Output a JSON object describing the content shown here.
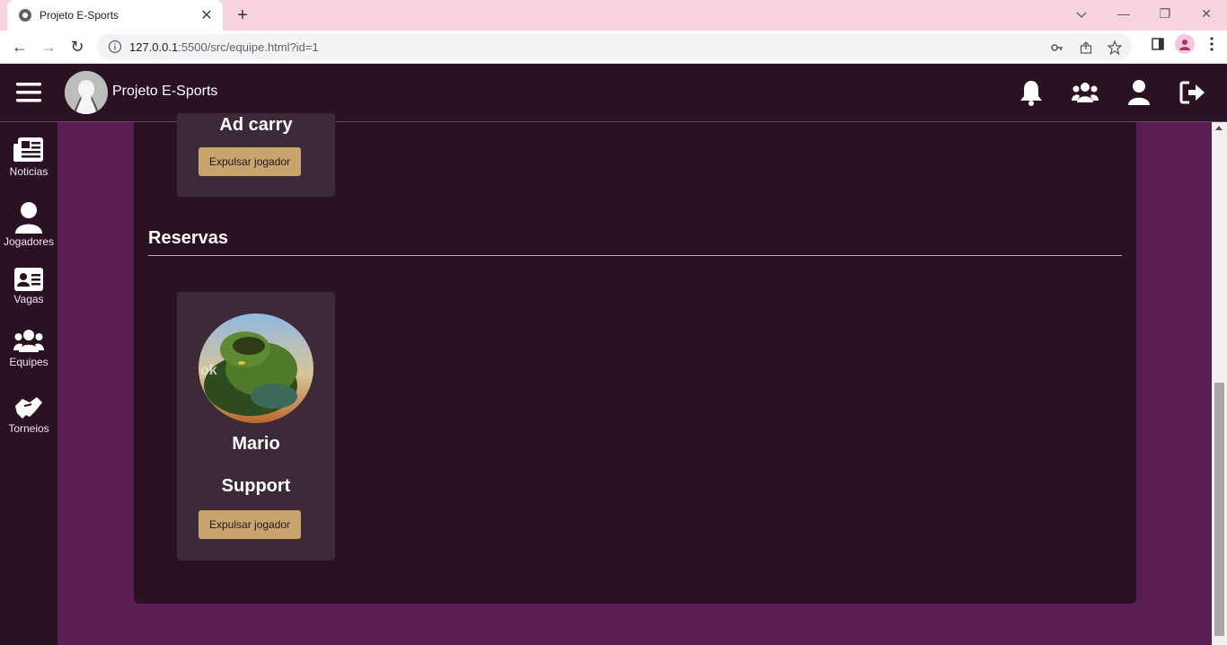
{
  "browser": {
    "tab_title": "Projeto E-Sports",
    "url_host": "127.0.0.1",
    "url_rest": ":5500/src/equipe.html?id=1"
  },
  "app": {
    "brand_name": "Projeto E-Sports",
    "sidebar": [
      {
        "label": "Noticias",
        "icon": "newspaper-icon"
      },
      {
        "label": "Jogadores",
        "icon": "user-icon"
      },
      {
        "label": "Vagas",
        "icon": "id-card-icon"
      },
      {
        "label": "Equipes",
        "icon": "users-icon"
      },
      {
        "label": "Torneios",
        "icon": "handshake-icon"
      }
    ],
    "top_icons": [
      "bell-icon",
      "users-icon",
      "user-icon",
      "logout-icon"
    ]
  },
  "team": {
    "top_card": {
      "role": "Ad carry",
      "button_label": "Expulsar jogador"
    },
    "reserves_title": "Reservas",
    "reserves": [
      {
        "name": "Mario",
        "role": "Support",
        "button_label": "Expulsar jogador"
      }
    ]
  },
  "colors": {
    "page_bg": "#5a1e52",
    "panel_bg": "#2a1223",
    "card_bg": "#3d2a38",
    "button_bg": "#c7a56c"
  }
}
